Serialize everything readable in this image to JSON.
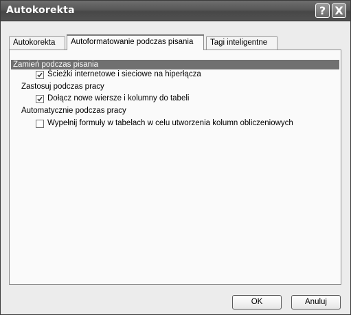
{
  "window": {
    "title": "Autokorekta"
  },
  "titlebar": {
    "help_glyph": "?",
    "close_glyph": "X"
  },
  "tabs": [
    {
      "label": "Autokorekta",
      "active": false
    },
    {
      "label": "Autoformatowanie podczas pisania",
      "active": true
    },
    {
      "label": "Tagi inteligentne",
      "active": false
    }
  ],
  "panel": {
    "replace_header": "Zamień podczas pisania",
    "hyperlinks": {
      "label": "Ścieżki internetowe i sieciowe na hiperłącza",
      "checked": true
    },
    "apply_header": "Zastosuj podczas pracy",
    "table_rows": {
      "label": "Dołącz nowe wiersze i kolumny do tabeli",
      "checked": true
    },
    "auto_header": "Automatycznie podczas pracy",
    "formulas": {
      "label": "Wypełnij formuły w tabelach w celu utworzenia kolumn obliczeniowych",
      "checked": false
    }
  },
  "buttons": {
    "ok": "OK",
    "cancel": "Anuluj"
  },
  "icons": {
    "check": "check-icon",
    "help": "help-icon",
    "close": "close-icon"
  }
}
